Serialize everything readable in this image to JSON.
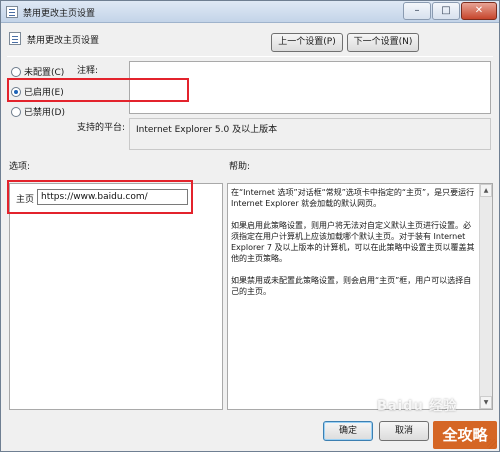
{
  "window": {
    "title": "禁用更改主页设置",
    "min_glyph": "–",
    "max_glyph": "□",
    "close_glyph": "✕"
  },
  "header": {
    "title": "禁用更改主页设置",
    "prev_label": "上一个设置(P)",
    "next_label": "下一个设置(N)"
  },
  "state": {
    "options": [
      {
        "label": "未配置(C)",
        "selected": false
      },
      {
        "label": "已启用(E)",
        "selected": true
      },
      {
        "label": "已禁用(D)",
        "selected": false
      }
    ]
  },
  "comment": {
    "label": "注释:",
    "value": ""
  },
  "platform": {
    "label": "支持的平台:",
    "value": "Internet Explorer 5.0 及以上版本"
  },
  "options_section": {
    "label": "选项:",
    "homepage_label": "主页",
    "homepage_value": "https://www.baidu.com/"
  },
  "help_section": {
    "label": "帮助:",
    "paragraphs": [
      "在“Internet 选项”对话框“常规”选项卡中指定的“主页”，是只要运行 Internet Explorer 就会加载的默认网页。",
      "如果启用此策略设置，则用户将无法对自定义默认主页进行设置。必须指定在用户计算机上应该加载哪个默认主页。对于装有 Internet Explorer 7 及以上版本的计算机，可以在此策略中设置主页以覆盖其他的主页策略。",
      "如果禁用或未配置此策略设置，则会启用“主页”框，用户可以选择自己的主页。"
    ]
  },
  "buttons": {
    "ok_label": "确定",
    "cancel_label": "取消"
  },
  "watermark": {
    "text": "Baidu 经验",
    "logo_text": "全攻略"
  }
}
